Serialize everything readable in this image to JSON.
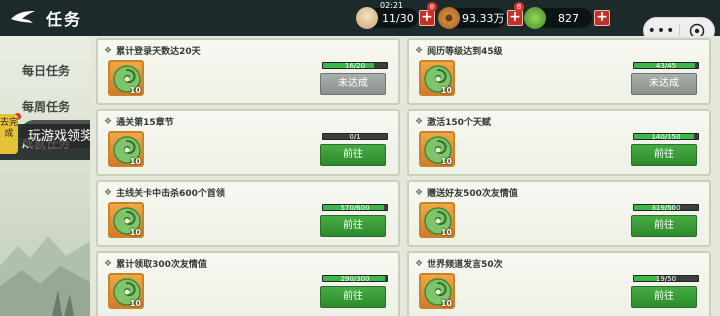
{
  "header": {
    "title": "任务",
    "clock": "02:21",
    "resources": [
      {
        "icon": "steamed-bun-icon",
        "value": "11/30",
        "badge": ""
      },
      {
        "icon": "copper-coin-icon",
        "value": "93.33万",
        "badge": "8"
      },
      {
        "icon": "jade-icon",
        "value": "827",
        "badge": "8"
      }
    ],
    "capsule": {
      "more": "•••"
    }
  },
  "sidebar": {
    "items": [
      {
        "label": "每日任务"
      },
      {
        "label": "每周任务"
      },
      {
        "label": "成就任务"
      }
    ],
    "tag": "去完成",
    "tooltip": "玩游戏领奖励"
  },
  "tasks": [
    {
      "title": "累计登录天数达20天",
      "progress": "16/20",
      "ratio": 0.8,
      "reward_qty": "10",
      "action": "未达成",
      "done": false
    },
    {
      "title": "阅历等级达到45级",
      "progress": "43/45",
      "ratio": 0.955,
      "reward_qty": "10",
      "action": "未达成",
      "done": false
    },
    {
      "title": "通关第15章节",
      "progress": "0/1",
      "ratio": 0,
      "reward_qty": "10",
      "action": "前往",
      "done": true
    },
    {
      "title": "激活150个天赋",
      "progress": "140/150",
      "ratio": 0.933,
      "reward_qty": "10",
      "action": "前往",
      "done": true
    },
    {
      "title": "主线关卡中击杀600个首领",
      "progress": "570/600",
      "ratio": 0.95,
      "reward_qty": "10",
      "action": "前往",
      "done": true
    },
    {
      "title": "赠送好友500次友情值",
      "progress": "319/500",
      "ratio": 0.638,
      "reward_qty": "10",
      "action": "前往",
      "done": true
    },
    {
      "title": "累计领取300次友情值",
      "progress": "290/300",
      "ratio": 0.967,
      "reward_qty": "10",
      "action": "前往",
      "done": true
    },
    {
      "title": "世界频道发言50次",
      "progress": "19/50",
      "ratio": 0.38,
      "reward_qty": "10",
      "action": "前往",
      "done": true
    }
  ],
  "colors": {
    "accent_green": "#3cb84a",
    "button_green": "#2d8a2c",
    "pending_gray": "#8a918c",
    "plus_red": "#c0322b"
  }
}
